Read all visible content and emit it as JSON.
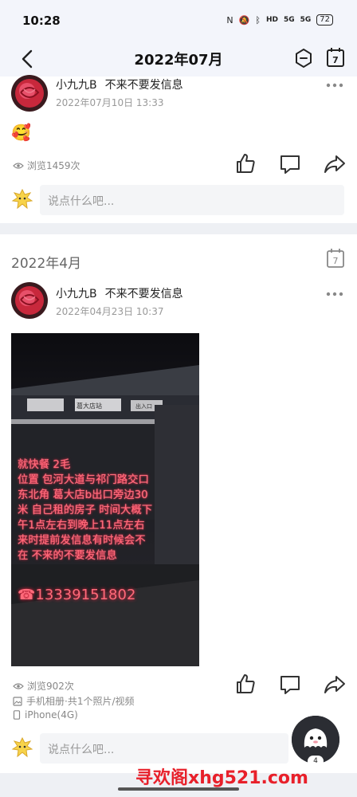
{
  "status_bar": {
    "time": "10:28",
    "network_left": "5G",
    "network_right": "5G",
    "hd": "HD",
    "battery": "72"
  },
  "header": {
    "title": "2022年07月",
    "calendar_day": "7"
  },
  "post1": {
    "username": "小九九B",
    "caption": "不来不要发信息",
    "timestamp": "2022年07月10日 13:33",
    "emoji": "🥰",
    "views": "浏览1459次",
    "comment_placeholder": "说点什么吧..."
  },
  "section": {
    "month": "2022年4月",
    "calendar_day": "7"
  },
  "post2": {
    "username": "小九九B",
    "caption": "不来不要发信息",
    "timestamp": "2022年04月23日 10:37",
    "image_text_lines": [
      "就快餐 2毛",
      "位置 包河大道与祁门路交口",
      "东北角 葛大店b出口旁边30",
      "米 自己租的房子 时间大概下",
      "午1点左右到晚上11点左右",
      "来时提前发信息有时候会不",
      "在 不来的不要发信息"
    ],
    "image_sign_1": "葛大店站",
    "image_sign_2": "出入口",
    "image_phone": "13339151802",
    "views": "浏览902次",
    "source": "手机相册·共1个照片/视频",
    "device": "iPhone(4G)",
    "comment_placeholder": "说点什么吧..."
  },
  "fab": {
    "badge": "4"
  },
  "watermark": "寻欢阁xhg521.com"
}
